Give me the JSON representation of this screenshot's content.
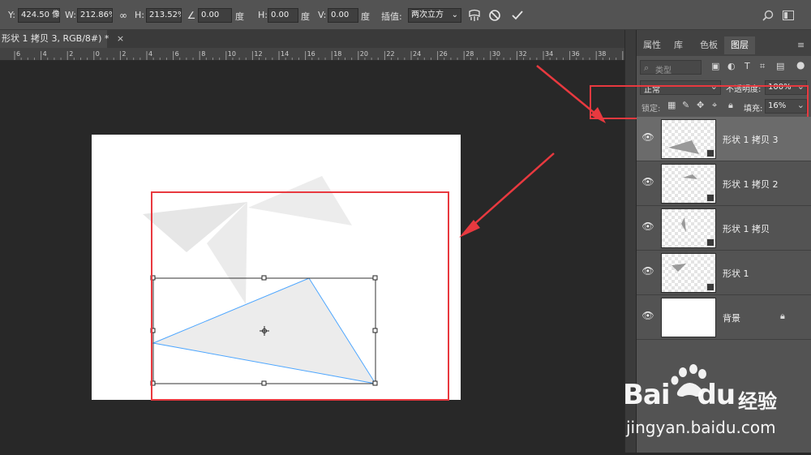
{
  "options_bar": {
    "y_label": "Y:",
    "y_value": "424.50 像素",
    "w_label": "W:",
    "w_value": "212.86%",
    "h_label": "H:",
    "h_value": "213.52%",
    "angle_value": "0.00",
    "angle_unit": "度",
    "hskew_label": "H:",
    "hskew_value": "0.00",
    "hskew_unit": "度",
    "vskew_label": "V:",
    "vskew_value": "0.00",
    "vskew_unit": "度",
    "interp_label": "插值:",
    "interp_value": "两次立方"
  },
  "document_tab": {
    "title": "形状 1 拷贝 3, RGB/8#) *",
    "close": "×"
  },
  "ruler": {
    "ticks": [
      "6",
      "4",
      "2",
      "0",
      "2",
      "4",
      "6",
      "8",
      "10",
      "12",
      "14",
      "16",
      "18",
      "20",
      "22",
      "24",
      "26",
      "28",
      "30",
      "32",
      "34",
      "36",
      "38",
      "40"
    ]
  },
  "panel": {
    "tabs": [
      "属性",
      "库",
      "色板",
      "图层"
    ],
    "active_tab": "图层",
    "filter_label": "类型",
    "blend_mode": "正常",
    "opacity_label": "不透明度:",
    "opacity_value": "100%",
    "lock_label": "锁定:",
    "fill_label": "填充:",
    "fill_value": "16%",
    "layers": [
      {
        "name": "形状 1 拷贝 3",
        "selected": true
      },
      {
        "name": "形状 1 拷贝 2",
        "selected": false
      },
      {
        "name": "形状 1 拷贝",
        "selected": false
      },
      {
        "name": "形状 1",
        "selected": false
      },
      {
        "name": "背景",
        "selected": false
      }
    ]
  },
  "watermark": {
    "brand_latin": "Bai",
    "brand_du": "du",
    "brand_cn": "经验",
    "url": "jingyan.baidu.com"
  },
  "colors": {
    "annotation_red": "#e8393f",
    "selection_blue": "#4da6ff",
    "panel_bg": "#535353",
    "canvas_bg": "#282828"
  }
}
